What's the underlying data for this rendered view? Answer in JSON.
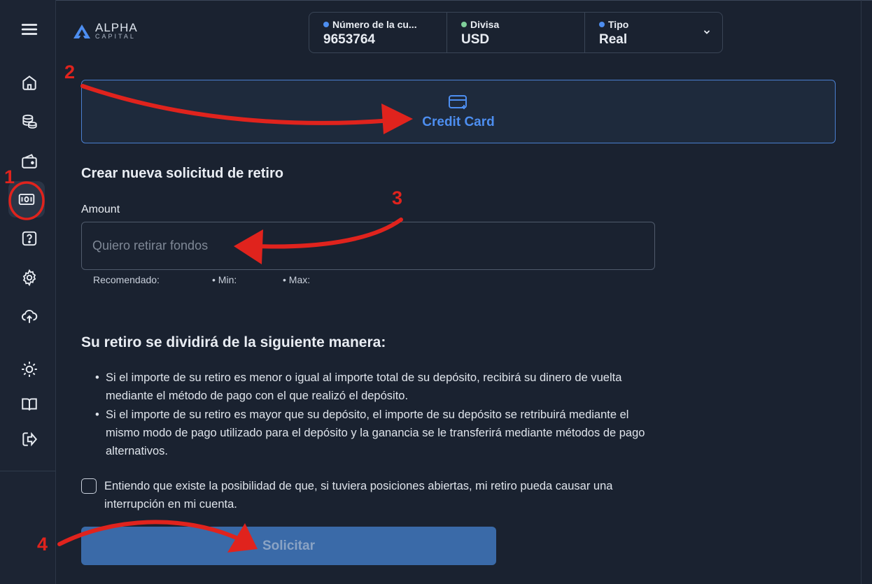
{
  "app": {
    "logo_line1": "ALPHA",
    "logo_line2": "CAPITAL"
  },
  "account_bar": {
    "account": {
      "label": "Número de la cu...",
      "value": "9653764",
      "dot_color": "#4d8ef0"
    },
    "currency": {
      "label": "Divisa",
      "value": "USD",
      "dot_color": "#7fcf9a"
    },
    "type": {
      "label": "Tipo",
      "value": "Real",
      "dot_color": "#4d8ef0"
    }
  },
  "sidebar": {
    "items": [
      {
        "name": "menu",
        "icon": "hamburger-icon"
      },
      {
        "name": "home",
        "icon": "home-icon"
      },
      {
        "name": "coins",
        "icon": "coins-icon"
      },
      {
        "name": "wallet",
        "icon": "wallet-icon"
      },
      {
        "name": "withdraw",
        "icon": "banknote-icon",
        "active": true
      },
      {
        "name": "help",
        "icon": "question-icon"
      },
      {
        "name": "settings",
        "icon": "gear-icon"
      },
      {
        "name": "upload",
        "icon": "cloud-upload-icon"
      },
      {
        "name": "theme",
        "icon": "sun-icon"
      },
      {
        "name": "docs",
        "icon": "book-icon"
      },
      {
        "name": "logout",
        "icon": "logout-icon"
      }
    ]
  },
  "payment_method": {
    "label": "Credit Card",
    "icon": "credit-card-plus-icon"
  },
  "form": {
    "title": "Crear nueva solicitud de retiro",
    "amount_label": "Amount",
    "amount_placeholder": "Quiero retirar fondos",
    "amount_value": "",
    "hint_recommended": "Recomendado:",
    "hint_min": "• Min:",
    "hint_max": "• Max:"
  },
  "split": {
    "title": "Su retiro se dividirá de la siguiente manera:",
    "bullets": [
      "Si el importe de su retiro es menor o igual al importe total de su depósito, recibirá su dinero de vuelta mediante el método de pago con el que realizó el depósito.",
      "Si el importe de su retiro es mayor que su depósito, el importe de su depósito se retribuirá mediante el mismo modo de pago utilizado para el depósito y la ganancia se le transferirá mediante métodos de pago alternativos."
    ]
  },
  "agreement": {
    "text": "Entiendo que existe la posibilidad de que, si tuviera posiciones abiertas, mi retiro pueda causar una interrupción en mi cuenta.",
    "checked": false
  },
  "submit_label": "Solicitar",
  "annotations": {
    "step1": "1",
    "step2": "2",
    "step3": "3",
    "step4": "4",
    "color": "#e0231d"
  }
}
